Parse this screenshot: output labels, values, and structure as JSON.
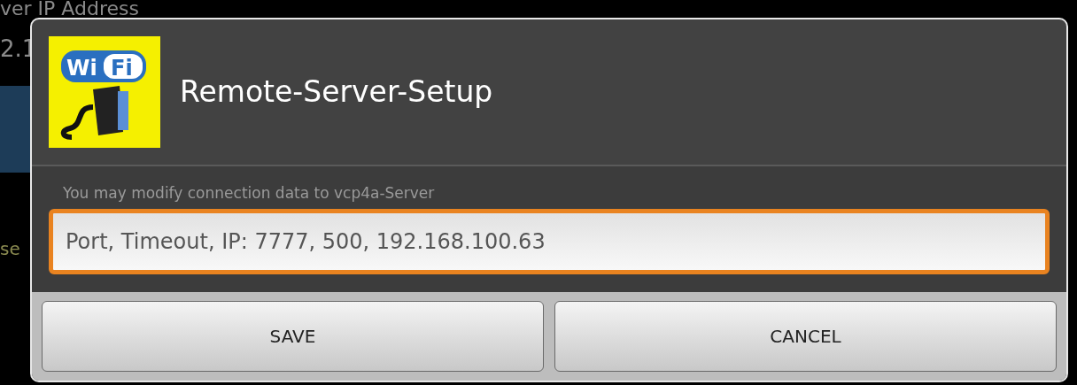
{
  "background": {
    "label": "ver IP Address",
    "value": "2.1",
    "hint": "se"
  },
  "dialog": {
    "logo": [
      "Wi",
      "Fi"
    ],
    "title": "Remote-Server-Setup",
    "message": "You may modify connection data to vcp4a-Server",
    "field": {
      "value": "Port, Timeout, IP: 7777, 500, 192.168.100.63",
      "focused": true
    },
    "buttons": [
      {
        "label": "SAVE"
      },
      {
        "label": "CANCEL"
      }
    ]
  }
}
